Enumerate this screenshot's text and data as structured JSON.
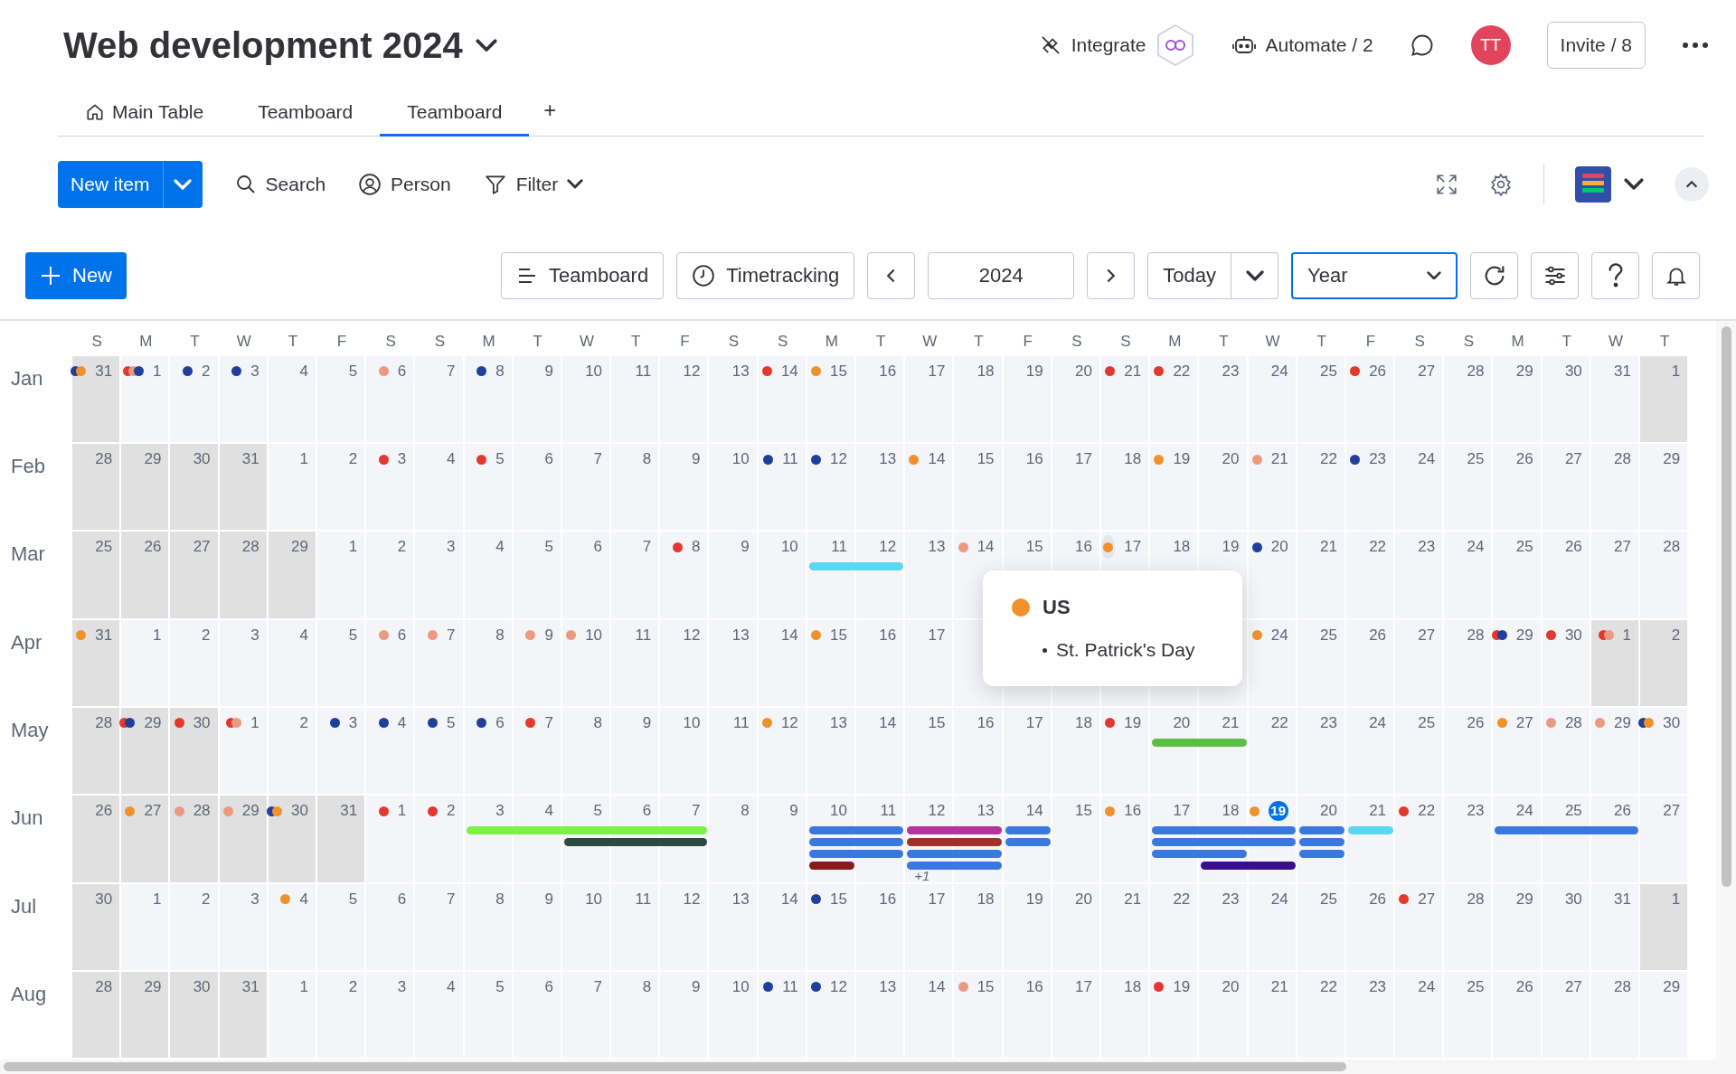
{
  "board": {
    "title": "Web development 2024"
  },
  "header_actions": {
    "integrate": "Integrate",
    "automate": "Automate / 2",
    "avatar": "TT",
    "invite": "Invite / 8"
  },
  "tabs": [
    {
      "label": "Main Table",
      "selected": false,
      "kind": "home"
    },
    {
      "label": "Teamboard",
      "selected": false,
      "kind": "plain"
    },
    {
      "label": "Teamboard",
      "selected": true,
      "kind": "plain"
    }
  ],
  "add_tab": "+",
  "toolbar": {
    "new_item": "New item",
    "search": "Search",
    "person": "Person",
    "filter": "Filter"
  },
  "calendar_toolbar": {
    "new": "New",
    "view": "Teamboard",
    "timetracking": "Timetracking",
    "year": "2024",
    "today": "Today",
    "range": "Year"
  },
  "weekdays": [
    "S",
    "M",
    "T",
    "W",
    "T",
    "F",
    "S",
    "S",
    "M",
    "T",
    "W",
    "T",
    "F",
    "S",
    "S",
    "M",
    "T",
    "W",
    "T",
    "F",
    "S",
    "S",
    "M",
    "T",
    "W",
    "T",
    "F",
    "S",
    "S",
    "M",
    "T",
    "W",
    "T"
  ],
  "months": [
    {
      "name": "Jan",
      "days": [
        {
          "label": "31",
          "outside": true,
          "dots": [
            {
              "color": "#1f3f99"
            },
            {
              "color": "#f0922b"
            }
          ]
        },
        {
          "label": "1",
          "outside": false,
          "dots": [
            {
              "color": "#e2382d"
            },
            {
              "color": "#eb9a82"
            },
            {
              "color": "#1f3f99"
            }
          ]
        },
        {
          "label": "2",
          "outside": false,
          "dots": [
            {
              "color": "#1f3f99"
            }
          ]
        },
        {
          "label": "3",
          "outside": false,
          "dots": [
            {
              "color": "#1f3f99"
            }
          ]
        },
        {
          "label": "4",
          "outside": false
        },
        {
          "label": "5",
          "outside": false
        },
        {
          "label": "6",
          "outside": false,
          "dots": [
            {
              "color": "#eb9a82"
            }
          ]
        },
        {
          "label": "7",
          "outside": false
        },
        {
          "label": "8",
          "outside": false,
          "dots": [
            {
              "color": "#1f3f99"
            }
          ]
        },
        {
          "label": "9",
          "outside": false
        },
        {
          "label": "10",
          "outside": false
        },
        {
          "label": "11",
          "outside": false
        },
        {
          "label": "12",
          "outside": false
        },
        {
          "label": "13",
          "outside": false
        },
        {
          "label": "14",
          "outside": false,
          "dots": [
            {
              "color": "#e2382d"
            }
          ]
        },
        {
          "label": "15",
          "outside": false,
          "dots": [
            {
              "color": "#f0922b"
            }
          ]
        },
        {
          "label": "16",
          "outside": false
        },
        {
          "label": "17",
          "outside": false
        },
        {
          "label": "18",
          "outside": false
        },
        {
          "label": "19",
          "outside": false
        },
        {
          "label": "20",
          "outside": false
        },
        {
          "label": "21",
          "outside": false,
          "dots": [
            {
              "color": "#e2382d"
            }
          ]
        },
        {
          "label": "22",
          "outside": false,
          "dots": [
            {
              "color": "#e2382d"
            }
          ]
        },
        {
          "label": "23",
          "outside": false
        },
        {
          "label": "24",
          "outside": false
        },
        {
          "label": "25",
          "outside": false
        },
        {
          "label": "26",
          "outside": false,
          "dots": [
            {
              "color": "#e2382d"
            }
          ]
        },
        {
          "label": "27",
          "outside": false
        },
        {
          "label": "28",
          "outside": false
        },
        {
          "label": "29",
          "outside": false
        },
        {
          "label": "30",
          "outside": false
        },
        {
          "label": "31",
          "outside": false
        },
        {
          "label": "1",
          "outside": true
        }
      ]
    },
    {
      "name": "Feb",
      "days": [
        {
          "label": "28",
          "outside": true
        },
        {
          "label": "29",
          "outside": true
        },
        {
          "label": "30",
          "outside": true
        },
        {
          "label": "31",
          "outside": true
        },
        {
          "label": "1",
          "outside": false
        },
        {
          "label": "2",
          "outside": false
        },
        {
          "label": "3",
          "outside": false,
          "dots": [
            {
              "color": "#e2382d"
            }
          ]
        },
        {
          "label": "4",
          "outside": false
        },
        {
          "label": "5",
          "outside": false,
          "dots": [
            {
              "color": "#e2382d"
            }
          ]
        },
        {
          "label": "6",
          "outside": false
        },
        {
          "label": "7",
          "outside": false
        },
        {
          "label": "8",
          "outside": false
        },
        {
          "label": "9",
          "outside": false
        },
        {
          "label": "10",
          "outside": false
        },
        {
          "label": "11",
          "outside": false,
          "dots": [
            {
              "color": "#1f3f99"
            }
          ]
        },
        {
          "label": "12",
          "outside": false,
          "dots": [
            {
              "color": "#1f3f99"
            }
          ]
        },
        {
          "label": "13",
          "outside": false
        },
        {
          "label": "14",
          "outside": false,
          "dots": [
            {
              "color": "#f0922b"
            }
          ]
        },
        {
          "label": "15",
          "outside": false
        },
        {
          "label": "16",
          "outside": false
        },
        {
          "label": "17",
          "outside": false
        },
        {
          "label": "18",
          "outside": false
        },
        {
          "label": "19",
          "outside": false,
          "dots": [
            {
              "color": "#f0922b"
            }
          ]
        },
        {
          "label": "20",
          "outside": false
        },
        {
          "label": "21",
          "outside": false,
          "dots": [
            {
              "color": "#eb9a82"
            }
          ]
        },
        {
          "label": "22",
          "outside": false
        },
        {
          "label": "23",
          "outside": false,
          "dots": [
            {
              "color": "#1f3f99"
            }
          ]
        },
        {
          "label": "24",
          "outside": false
        },
        {
          "label": "25",
          "outside": false
        },
        {
          "label": "26",
          "outside": false
        },
        {
          "label": "27",
          "outside": false
        },
        {
          "label": "28",
          "outside": false
        },
        {
          "label": "29",
          "outside": false
        }
      ]
    },
    {
      "name": "Mar",
      "days": [
        {
          "label": "25",
          "outside": true
        },
        {
          "label": "26",
          "outside": true
        },
        {
          "label": "27",
          "outside": true
        },
        {
          "label": "28",
          "outside": true
        },
        {
          "label": "29",
          "outside": true
        },
        {
          "label": "1",
          "outside": false
        },
        {
          "label": "2",
          "outside": false
        },
        {
          "label": "3",
          "outside": false
        },
        {
          "label": "4",
          "outside": false
        },
        {
          "label": "5",
          "outside": false
        },
        {
          "label": "6",
          "outside": false
        },
        {
          "label": "7",
          "outside": false
        },
        {
          "label": "8",
          "outside": false,
          "dots": [
            {
              "color": "#e2382d"
            }
          ]
        },
        {
          "label": "9",
          "outside": false
        },
        {
          "label": "10",
          "outside": false
        },
        {
          "label": "11",
          "outside": false,
          "events": {
            "lane_1": {
              "color": "#5ad8f0",
              "starts": true,
              "ends": false
            }
          }
        },
        {
          "label": "12",
          "outside": false,
          "events": {
            "lane_1": {
              "color": "#5ad8f0",
              "starts": false,
              "ends": true
            }
          }
        },
        {
          "label": "13",
          "outside": false
        },
        {
          "label": "14",
          "outside": false,
          "dots": [
            {
              "color": "#eb9a82"
            }
          ]
        },
        {
          "label": "15",
          "outside": false
        },
        {
          "label": "16",
          "outside": false
        },
        {
          "label": "17",
          "outside": false,
          "hovered": true,
          "dots": [
            {
              "color": "#f0922b"
            }
          ]
        },
        {
          "label": "18",
          "outside": false
        },
        {
          "label": "19",
          "outside": false
        },
        {
          "label": "20",
          "outside": false,
          "dots": [
            {
              "color": "#1f3f99"
            }
          ]
        },
        {
          "label": "21",
          "outside": false
        },
        {
          "label": "22",
          "outside": false
        },
        {
          "label": "23",
          "outside": false
        },
        {
          "label": "24",
          "outside": false
        },
        {
          "label": "25",
          "outside": false
        },
        {
          "label": "26",
          "outside": false
        },
        {
          "label": "27",
          "outside": false
        },
        {
          "label": "28",
          "outside": false
        }
      ]
    },
    {
      "name": "Apr",
      "days": [
        {
          "label": "31",
          "outside": true,
          "dots": [
            {
              "color": "#f0922b"
            }
          ]
        },
        {
          "label": "1",
          "outside": false
        },
        {
          "label": "2",
          "outside": false
        },
        {
          "label": "3",
          "outside": false
        },
        {
          "label": "4",
          "outside": false
        },
        {
          "label": "5",
          "outside": false
        },
        {
          "label": "6",
          "outside": false,
          "dots": [
            {
              "color": "#eb9a82"
            }
          ]
        },
        {
          "label": "7",
          "outside": false,
          "dots": [
            {
              "color": "#eb9a82"
            }
          ]
        },
        {
          "label": "8",
          "outside": false
        },
        {
          "label": "9",
          "outside": false,
          "dots": [
            {
              "color": "#eb9a82"
            }
          ]
        },
        {
          "label": "10",
          "outside": false,
          "dots": [
            {
              "color": "#eb9a82"
            }
          ]
        },
        {
          "label": "11",
          "outside": false
        },
        {
          "label": "12",
          "outside": false
        },
        {
          "label": "13",
          "outside": false
        },
        {
          "label": "14",
          "outside": false
        },
        {
          "label": "15",
          "outside": false,
          "dots": [
            {
              "color": "#f0922b"
            }
          ]
        },
        {
          "label": "16",
          "outside": false
        },
        {
          "label": "17",
          "outside": false
        },
        {
          "outside": false
        },
        {
          "outside": false
        },
        {
          "outside": false
        },
        {
          "outside": false
        },
        {
          "outside": false
        },
        {
          "outside": false
        },
        {
          "label": "24",
          "outside": false,
          "dots": [
            {
              "color": "#f0922b"
            }
          ]
        },
        {
          "label": "25",
          "outside": false
        },
        {
          "label": "26",
          "outside": false
        },
        {
          "label": "27",
          "outside": false
        },
        {
          "label": "28",
          "outside": false
        },
        {
          "label": "29",
          "outside": false,
          "dots": [
            {
              "color": "#e2382d"
            },
            {
              "color": "#1f3f99"
            }
          ]
        },
        {
          "label": "30",
          "outside": false,
          "dots": [
            {
              "color": "#e2382d"
            }
          ]
        },
        {
          "label": "1",
          "outside": true,
          "dots": [
            {
              "color": "#e2382d"
            },
            {
              "color": "#eb9a82"
            }
          ]
        },
        {
          "label": "2",
          "outside": true
        }
      ]
    },
    {
      "name": "May",
      "days": [
        {
          "label": "28",
          "outside": true
        },
        {
          "label": "29",
          "outside": true,
          "dots": [
            {
              "color": "#e2382d"
            },
            {
              "color": "#1f3f99"
            }
          ]
        },
        {
          "label": "30",
          "outside": true,
          "dots": [
            {
              "color": "#e2382d"
            }
          ]
        },
        {
          "label": "1",
          "outside": false,
          "dots": [
            {
              "color": "#e2382d"
            },
            {
              "color": "#eb9a82"
            }
          ]
        },
        {
          "label": "2",
          "outside": false
        },
        {
          "label": "3",
          "outside": false,
          "dots": [
            {
              "color": "#1f3f99"
            }
          ]
        },
        {
          "label": "4",
          "outside": false,
          "dots": [
            {
              "color": "#1f3f99"
            }
          ]
        },
        {
          "label": "5",
          "outside": false,
          "dots": [
            {
              "color": "#1f3f99"
            }
          ]
        },
        {
          "label": "6",
          "outside": false,
          "dots": [
            {
              "color": "#1f3f99"
            }
          ]
        },
        {
          "label": "7",
          "outside": false,
          "dots": [
            {
              "color": "#e2382d"
            }
          ]
        },
        {
          "label": "8",
          "outside": false
        },
        {
          "label": "9",
          "outside": false
        },
        {
          "label": "10",
          "outside": false
        },
        {
          "label": "11",
          "outside": false
        },
        {
          "label": "12",
          "outside": false,
          "dots": [
            {
              "color": "#f0922b"
            }
          ]
        },
        {
          "label": "13",
          "outside": false
        },
        {
          "label": "14",
          "outside": false
        },
        {
          "label": "15",
          "outside": false
        },
        {
          "label": "16",
          "outside": false
        },
        {
          "label": "17",
          "outside": false
        },
        {
          "label": "18",
          "outside": false
        },
        {
          "label": "19",
          "outside": false,
          "dots": [
            {
              "color": "#e2382d"
            }
          ]
        },
        {
          "label": "20",
          "outside": false,
          "events": {
            "lane_1": {
              "color": "#5cbf45",
              "starts": true,
              "ends": false
            }
          }
        },
        {
          "label": "21",
          "outside": false,
          "events": {
            "lane_1": {
              "color": "#5cbf45",
              "starts": false,
              "ends": true
            }
          }
        },
        {
          "label": "22",
          "outside": false
        },
        {
          "label": "23",
          "outside": false
        },
        {
          "label": "24",
          "outside": false
        },
        {
          "label": "25",
          "outside": false
        },
        {
          "label": "26",
          "outside": false
        },
        {
          "label": "27",
          "outside": false,
          "dots": [
            {
              "color": "#f0922b"
            }
          ]
        },
        {
          "label": "28",
          "outside": false,
          "dots": [
            {
              "color": "#eb9a82"
            }
          ]
        },
        {
          "label": "29",
          "outside": false,
          "dots": [
            {
              "color": "#eb9a82"
            }
          ]
        },
        {
          "label": "30",
          "outside": false,
          "dots": [
            {
              "color": "#1f3f99"
            },
            {
              "color": "#f0922b"
            }
          ]
        }
      ]
    },
    {
      "name": "Jun",
      "days": [
        {
          "label": "26",
          "outside": true
        },
        {
          "label": "27",
          "outside": true,
          "dots": [
            {
              "color": "#f0922b"
            }
          ]
        },
        {
          "label": "28",
          "outside": true,
          "dots": [
            {
              "color": "#eb9a82"
            }
          ]
        },
        {
          "label": "29",
          "outside": true,
          "dots": [
            {
              "color": "#eb9a82"
            }
          ]
        },
        {
          "label": "30",
          "outside": true,
          "dots": [
            {
              "color": "#1f3f99"
            },
            {
              "color": "#f0922b"
            }
          ]
        },
        {
          "label": "31",
          "outside": true
        },
        {
          "label": "1",
          "outside": false,
          "dots": [
            {
              "color": "#e2382d"
            }
          ]
        },
        {
          "label": "2",
          "outside": false,
          "dots": [
            {
              "color": "#e2382d"
            }
          ]
        },
        {
          "label": "3",
          "outside": false,
          "events": {
            "lane_1": {
              "color": "#7ef04a",
              "starts": true,
              "ends": false
            }
          }
        },
        {
          "label": "4",
          "outside": false,
          "events": {
            "lane_1": {
              "color": "#7ef04a",
              "starts": false,
              "ends": false
            }
          }
        },
        {
          "label": "5",
          "outside": false,
          "events": {
            "lane_1": {
              "color": "#7ef04a",
              "starts": false,
              "ends": false
            },
            "lane_2": {
              "color": "#2d4a3e",
              "starts": true,
              "ends": false
            }
          }
        },
        {
          "label": "6",
          "outside": false,
          "events": {
            "lane_1": {
              "color": "#7ef04a",
              "starts": false,
              "ends": false
            },
            "lane_2": {
              "color": "#2d4a3e",
              "starts": false,
              "ends": false
            }
          }
        },
        {
          "label": "7",
          "outside": false,
          "events": {
            "lane_1": {
              "color": "#7ef04a",
              "starts": false,
              "ends": true
            },
            "lane_2": {
              "color": "#2d4a3e",
              "starts": false,
              "ends": true
            }
          }
        },
        {
          "label": "8",
          "outside": false
        },
        {
          "label": "9",
          "outside": false
        },
        {
          "label": "10",
          "outside": false,
          "events": {
            "lane_1": {
              "color": "#3a78e0",
              "starts": true,
              "ends": false
            },
            "lane_2": {
              "color": "#3a78e0",
              "starts": true,
              "ends": false
            },
            "lane_3": {
              "color": "#3a78e0",
              "starts": true,
              "ends": false
            },
            "lane_4": {
              "color": "#8b1a1a",
              "starts": true,
              "ends": true
            }
          }
        },
        {
          "label": "11",
          "outside": false,
          "events": {
            "lane_1": {
              "color": "#3a78e0",
              "starts": false,
              "ends": true
            },
            "lane_2": {
              "color": "#3a78e0",
              "starts": false,
              "ends": true
            },
            "lane_3": {
              "color": "#3a78e0",
              "starts": false,
              "ends": true
            }
          }
        },
        {
          "label": "12",
          "outside": false,
          "more": "+1",
          "events": {
            "lane_1": {
              "color": "#b5339c",
              "starts": true,
              "ends": false
            },
            "lane_2": {
              "color": "#a0302a",
              "starts": true,
              "ends": false
            },
            "lane_3": {
              "color": "#3a78e0",
              "starts": true,
              "ends": false
            },
            "lane_4": {
              "color": "#3a78e0",
              "starts": true,
              "ends": false
            }
          }
        },
        {
          "label": "13",
          "outside": false,
          "events": {
            "lane_1": {
              "color": "#b5339c",
              "starts": false,
              "ends": true
            },
            "lane_2": {
              "color": "#a0302a",
              "starts": false,
              "ends": true
            },
            "lane_3": {
              "color": "#3a78e0",
              "starts": false,
              "ends": true
            },
            "lane_4": {
              "color": "#3a78e0",
              "starts": false,
              "ends": true
            }
          }
        },
        {
          "label": "14",
          "outside": false,
          "events": {
            "lane_1": {
              "color": "#3a78e0",
              "starts": true,
              "ends": true
            },
            "lane_2": {
              "color": "#3a78e0",
              "starts": true,
              "ends": true
            }
          }
        },
        {
          "label": "15",
          "outside": false
        },
        {
          "label": "16",
          "outside": false,
          "dots": [
            {
              "color": "#f0922b"
            }
          ]
        },
        {
          "label": "17",
          "outside": false,
          "events": {
            "lane_1": {
              "color": "#3a78e0",
              "starts": true,
              "ends": false
            },
            "lane_2": {
              "color": "#3a78e0",
              "starts": true,
              "ends": false
            },
            "lane_3": {
              "color": "#3a78e0",
              "starts": true,
              "ends": false
            }
          }
        },
        {
          "label": "18",
          "outside": false,
          "events": {
            "lane_1": {
              "color": "#3a78e0",
              "starts": false,
              "ends": false
            },
            "lane_2": {
              "color": "#3a78e0",
              "starts": false,
              "ends": false
            },
            "lane_3": {
              "color": "#3a78e0",
              "starts": false,
              "ends": true
            },
            "lane_4": {
              "color": "#3a0f8c",
              "starts": true,
              "ends": false
            }
          }
        },
        {
          "label": "19",
          "outside": false,
          "today": true,
          "dots": [
            {
              "color": "#f0922b"
            }
          ],
          "events": {
            "lane_1": {
              "color": "#3a78e0",
              "starts": false,
              "ends": true
            },
            "lane_2": {
              "color": "#3a78e0",
              "starts": false,
              "ends": true
            },
            "lane_4": {
              "color": "#3a0f8c",
              "starts": false,
              "ends": true
            }
          }
        },
        {
          "label": "20",
          "outside": false,
          "events": {
            "lane_1": {
              "color": "#3a78e0",
              "starts": true,
              "ends": true
            },
            "lane_2": {
              "color": "#3a78e0",
              "starts": true,
              "ends": true
            },
            "lane_3": {
              "color": "#3a78e0",
              "starts": true,
              "ends": true
            }
          }
        },
        {
          "label": "21",
          "outside": false,
          "events": {
            "lane_1": {
              "color": "#5ad8f0",
              "starts": true,
              "ends": true
            }
          }
        },
        {
          "label": "22",
          "outside": false,
          "dots": [
            {
              "color": "#e2382d"
            }
          ]
        },
        {
          "label": "23",
          "outside": false
        },
        {
          "label": "24",
          "outside": false,
          "events": {
            "lane_1": {
              "color": "#3a78e0",
              "starts": true,
              "ends": false
            }
          }
        },
        {
          "label": "25",
          "outside": false,
          "events": {
            "lane_1": {
              "color": "#3a78e0",
              "starts": false,
              "ends": false
            }
          }
        },
        {
          "label": "26",
          "outside": false,
          "events": {
            "lane_1": {
              "color": "#3a78e0",
              "starts": false,
              "ends": true
            }
          }
        },
        {
          "label": "27",
          "outside": false
        }
      ]
    },
    {
      "name": "Jul",
      "days": [
        {
          "label": "30",
          "outside": true
        },
        {
          "label": "1",
          "outside": false
        },
        {
          "label": "2",
          "outside": false
        },
        {
          "label": "3",
          "outside": false
        },
        {
          "label": "4",
          "outside": false,
          "dots": [
            {
              "color": "#f0922b"
            }
          ]
        },
        {
          "label": "5",
          "outside": false
        },
        {
          "label": "6",
          "outside": false
        },
        {
          "label": "7",
          "outside": false
        },
        {
          "label": "8",
          "outside": false
        },
        {
          "label": "9",
          "outside": false
        },
        {
          "label": "10",
          "outside": false
        },
        {
          "label": "11",
          "outside": false
        },
        {
          "label": "12",
          "outside": false
        },
        {
          "label": "13",
          "outside": false
        },
        {
          "label": "14",
          "outside": false
        },
        {
          "label": "15",
          "outside": false,
          "dots": [
            {
              "color": "#1f3f99"
            }
          ]
        },
        {
          "label": "16",
          "outside": false
        },
        {
          "label": "17",
          "outside": false
        },
        {
          "label": "18",
          "outside": false
        },
        {
          "label": "19",
          "outside": false
        },
        {
          "label": "20",
          "outside": false
        },
        {
          "label": "21",
          "outside": false
        },
        {
          "label": "22",
          "outside": false
        },
        {
          "label": "23",
          "outside": false
        },
        {
          "label": "24",
          "outside": false
        },
        {
          "label": "25",
          "outside": false
        },
        {
          "label": "26",
          "outside": false
        },
        {
          "label": "27",
          "outside": false,
          "dots": [
            {
              "color": "#e2382d"
            }
          ]
        },
        {
          "label": "28",
          "outside": false
        },
        {
          "label": "29",
          "outside": false
        },
        {
          "label": "30",
          "outside": false
        },
        {
          "label": "31",
          "outside": false
        },
        {
          "label": "1",
          "outside": true
        }
      ]
    },
    {
      "name": "Aug",
      "days": [
        {
          "label": "28",
          "outside": true
        },
        {
          "label": "29",
          "outside": true
        },
        {
          "label": "30",
          "outside": true
        },
        {
          "label": "31",
          "outside": true
        },
        {
          "label": "1",
          "outside": false
        },
        {
          "label": "2",
          "outside": false
        },
        {
          "label": "3",
          "outside": false
        },
        {
          "label": "4",
          "outside": false
        },
        {
          "label": "5",
          "outside": false
        },
        {
          "label": "6",
          "outside": false
        },
        {
          "label": "7",
          "outside": false
        },
        {
          "label": "8",
          "outside": false
        },
        {
          "label": "9",
          "outside": false
        },
        {
          "label": "10",
          "outside": false
        },
        {
          "label": "11",
          "outside": false,
          "dots": [
            {
              "color": "#1f3f99"
            }
          ]
        },
        {
          "label": "12",
          "outside": false,
          "dots": [
            {
              "color": "#1f3f99"
            }
          ]
        },
        {
          "label": "13",
          "outside": false
        },
        {
          "label": "14",
          "outside": false
        },
        {
          "label": "15",
          "outside": false,
          "dots": [
            {
              "color": "#eb9a82"
            }
          ]
        },
        {
          "label": "16",
          "outside": false
        },
        {
          "label": "17",
          "outside": false
        },
        {
          "label": "18",
          "outside": false
        },
        {
          "label": "19",
          "outside": false,
          "dots": [
            {
              "color": "#e2382d"
            }
          ]
        },
        {
          "label": "20",
          "outside": false
        },
        {
          "label": "21",
          "outside": false
        },
        {
          "label": "22",
          "outside": false
        },
        {
          "label": "23",
          "outside": false
        },
        {
          "label": "24",
          "outside": false
        },
        {
          "label": "25",
          "outside": false
        },
        {
          "label": "26",
          "outside": false
        },
        {
          "label": "27",
          "outside": false
        },
        {
          "label": "28",
          "outside": false
        },
        {
          "label": "29",
          "outside": false
        }
      ]
    }
  ],
  "tooltip": {
    "region": "US",
    "color": "#f0922b",
    "holiday": "St. Patrick's Day"
  }
}
